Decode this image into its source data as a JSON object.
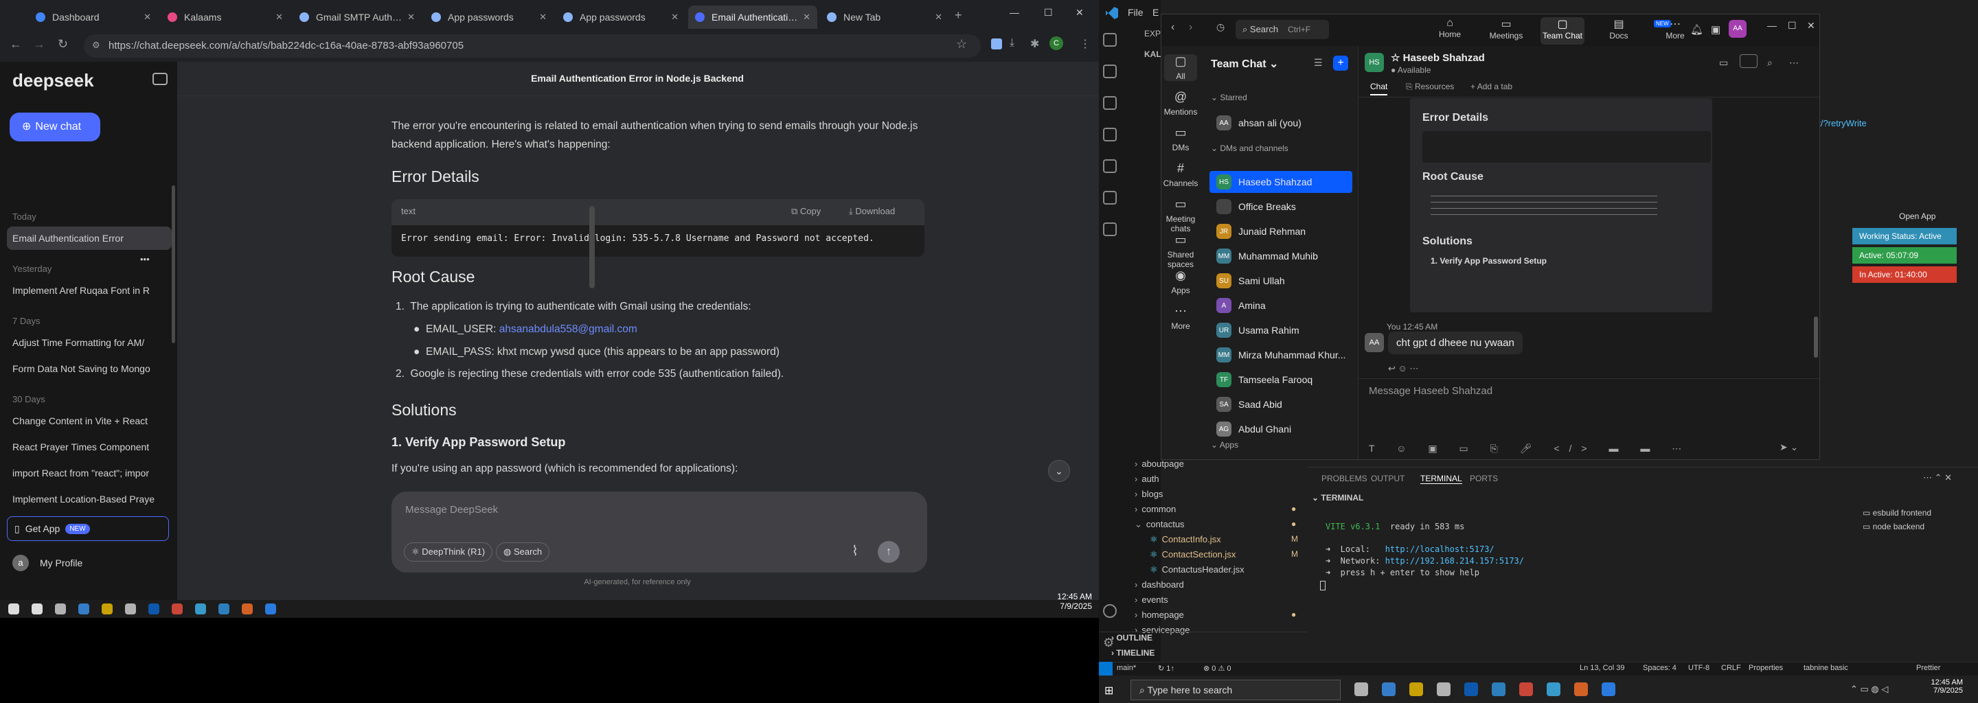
{
  "chrome": {
    "tabs": [
      {
        "label": "Dashboard",
        "color": "#4285f4"
      },
      {
        "label": "Kalaams",
        "color": "#e64980"
      },
      {
        "label": "Gmail SMTP Authentic",
        "color": "#8ab4f8"
      },
      {
        "label": "App passwords",
        "color": "#8ab4f8"
      },
      {
        "label": "App passwords",
        "color": "#8ab4f8"
      },
      {
        "label": "Email Authentication E",
        "color": "#4d6bfe"
      },
      {
        "label": "New Tab",
        "color": "#8ab4f8"
      }
    ],
    "url": "https://chat.deepseek.com/a/chat/s/bab224dc-c16a-40ae-8783-abf93a960705",
    "win_min": "—",
    "win_max": "☐",
    "win_close": "✕",
    "new_tab": "+"
  },
  "deepseek": {
    "logo": "deepseek",
    "new_chat": "New chat",
    "sections": [
      {
        "label": "Today",
        "items": [
          "Email Authentication Error"
        ]
      },
      {
        "label": "Yesterday",
        "items": [
          "Implement Aref Ruqaa Font in R"
        ]
      },
      {
        "label": "7 Days",
        "items": [
          "Adjust Time Formatting for AM/",
          "Form Data Not Saving to Mongo"
        ]
      },
      {
        "label": "30 Days",
        "items": [
          "Change Content in Vite + React",
          "React Prayer Times Component",
          "import React from \"react\"; impor",
          "Implement Location-Based Praye"
        ]
      }
    ],
    "get_app": "Get App",
    "get_app_badge": "NEW",
    "profile": "My Profile",
    "profile_initial": "a",
    "chat_title": "Email Authentication Error in Node.js Backend",
    "intro": "The error you're encountering is related to email authentication when trying to send emails through your Node.js backend application. Here's what's happening:",
    "h_details": "Error Details",
    "code_lang": "text",
    "copy": "Copy",
    "download": "Download",
    "code": "Error sending email: Error: Invalid login: 535-5.7.8 Username and Password not accepted.",
    "h_root": "Root Cause",
    "root1": "The application is trying to authenticate with Gmail using the credentials:",
    "user_label": "EMAIL_USER: ",
    "user_val": "ahsanabdula558@gmail.com",
    "pass_line": "EMAIL_PASS: khxt mcwp ywsd quce (this appears to be an app password)",
    "root2": "Google is rejecting these credentials with error code 535 (authentication failed).",
    "h_sol": "Solutions",
    "h_verify": "1. Verify App Password Setup",
    "verify_text": "If you're using an app password (which is recommended for applications):",
    "input_placeholder": "Message DeepSeek",
    "deepthink": "DeepThink (R1)",
    "search": "Search",
    "footer": "AI-generated, for reference only"
  },
  "taskbar": {
    "time": "12:45 AM",
    "date": "7/9/2025"
  },
  "vscode": {
    "menu": [
      "File",
      "E"
    ],
    "explorer_label": "EXP",
    "kal": "KAL",
    "tree": [
      {
        "name": "aboutpage",
        "type": "folder",
        "mod": ""
      },
      {
        "name": "auth",
        "type": "folder",
        "mod": ""
      },
      {
        "name": "blogs",
        "type": "folder",
        "mod": ""
      },
      {
        "name": "common",
        "type": "folder",
        "mod": "dot"
      },
      {
        "name": "contactus",
        "type": "folder-open",
        "mod": "dot"
      },
      {
        "name": "ContactInfo.jsx",
        "type": "file",
        "mod": "M"
      },
      {
        "name": "ContactSection.jsx",
        "type": "file",
        "mod": "M"
      },
      {
        "name": "ContactusHeader.jsx",
        "type": "file",
        "mod": ""
      },
      {
        "name": "dashboard",
        "type": "folder",
        "mod": ""
      },
      {
        "name": "events",
        "type": "folder",
        "mod": ""
      },
      {
        "name": "homepage",
        "type": "folder",
        "mod": "dot"
      },
      {
        "name": "servicepage",
        "type": "folder",
        "mod": ""
      }
    ],
    "outline": "OUTLINE",
    "timeline": "TIMELINE",
    "panel_tabs": [
      "PROBLEMS",
      "OUTPUT",
      "TERMINAL",
      "PORTS"
    ],
    "terminal_title": "TERMINAL",
    "term_lines": [
      {
        "a": "VITE v6.3.1",
        "b": "  ready in 583 ms"
      },
      {
        "a": "➜  Local:",
        "b": "   http://localhost:5173/"
      },
      {
        "a": "➜  Network:",
        "b": " http://192.168.214.157:5173/"
      },
      {
        "a": "➜  press h + enter to show help",
        "b": ""
      }
    ],
    "shells": [
      "esbuild frontend",
      "node backend"
    ],
    "editor_frag": "et/?retryWrite",
    "open_app": "Open App",
    "status_cards": [
      {
        "label": "Working Status: Active",
        "color": "#2f8fb5"
      },
      {
        "label": "Active: 05:07:09",
        "color": "#2e9e4a"
      },
      {
        "label": "In Active: 01:40:00",
        "color": "#d23b2c"
      }
    ],
    "statusbar": {
      "branch": "main*",
      "sync": "↻ 1↑",
      "problems": "⊗ 0 ⚠ 0",
      "pos": "Ln 13, Col 39",
      "spaces": "Spaces: 4",
      "enc": "UTF-8",
      "eol": "CRLF",
      "props": "Properties",
      "tabnine": "tabnine basic",
      "prettier": "Prettier"
    }
  },
  "teams": {
    "search": "Search",
    "shortcut": "Ctrl+F",
    "top_nav": [
      "Home",
      "Meetings",
      "Team Chat",
      "Docs",
      "More"
    ],
    "new_badge": "NEW",
    "avatar_initials": "AA",
    "left_nav": [
      "All",
      "Mentions",
      "DMs",
      "Channels",
      "Meeting chats",
      "Shared spaces",
      "Apps",
      "More"
    ],
    "panel_title": "Team Chat",
    "starred": "Starred",
    "dms_label": "DMs and channels",
    "apps_label": "Apps",
    "contacts": [
      {
        "name": "ahsan ali (you)",
        "initials": "AA",
        "color": "#5a5a5a",
        "section": "starred"
      },
      {
        "name": "Haseeb Shahzad",
        "initials": "HS",
        "color": "#2d8c5a",
        "selected": true
      },
      {
        "name": "Office Breaks",
        "initials": "",
        "color": "#444"
      },
      {
        "name": "Junaid Rehman",
        "initials": "JR",
        "color": "#c58a1e"
      },
      {
        "name": "Muhammad Muhib",
        "initials": "MM",
        "color": "#3b7a8c"
      },
      {
        "name": "Sami Ullah",
        "initials": "SU",
        "color": "#c58a1e"
      },
      {
        "name": "Amina",
        "initials": "A",
        "color": "#7a4fb0"
      },
      {
        "name": "Usama Rahim",
        "initials": "UR",
        "color": "#3b7a8c"
      },
      {
        "name": "Mirza Muhammad Khur...",
        "initials": "MM",
        "color": "#3b7a8c"
      },
      {
        "name": "Tamseela Farooq",
        "initials": "TF",
        "color": "#2d8c5a"
      },
      {
        "name": "Saad Abid",
        "initials": "SA",
        "color": "#5a5a5a"
      },
      {
        "name": "Abdul Ghani",
        "initials": "AG",
        "color": "#777"
      }
    ],
    "chat_name": "Haseeb Shahzad",
    "chat_status": "Available",
    "chat_initials": "HS",
    "chat_tabs": [
      "Chat",
      "Resources",
      "Add a tab"
    ],
    "msg_meta": "You 12:45 AM",
    "msg_text": "cht gpt d dheee nu ywaan",
    "input_placeholder": "Message Haseeb Shahzad"
  },
  "taskbar2": {
    "search": "Type here to search",
    "time": "12:45 AM",
    "date": "7/9/2025"
  }
}
